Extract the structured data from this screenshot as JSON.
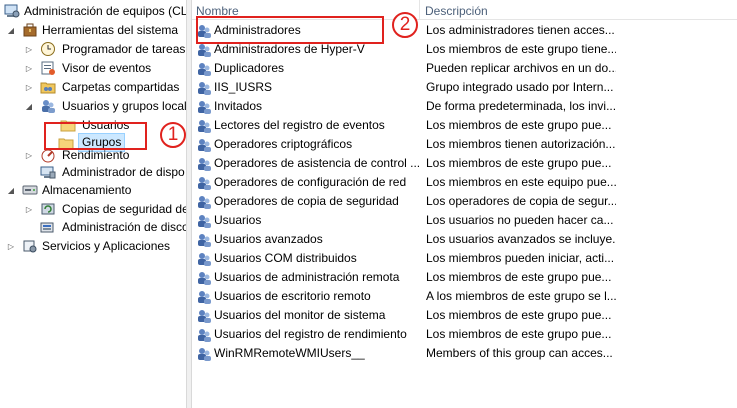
{
  "tree": {
    "root": "Administración de equipos (CL",
    "system_tools": "Herramientas del sistema",
    "task_scheduler": "Programador de tareas",
    "event_viewer": "Visor de eventos",
    "shared_folders": "Carpetas compartidas",
    "local_users_groups": "Usuarios y grupos locales",
    "users": "Usuarios",
    "groups": "Grupos",
    "performance": "Rendimiento",
    "device_manager": "Administrador de dispo",
    "storage": "Almacenamiento",
    "backup": "Copias de seguridad de",
    "disk_management": "Administración de disco",
    "services": "Servicios y Aplicaciones"
  },
  "columns": {
    "name": "Nombre",
    "description": "Descripción"
  },
  "groups": [
    {
      "name": "Administradores",
      "desc": "Los administradores tienen acces..."
    },
    {
      "name": "Administradores de Hyper-V",
      "desc": "Los miembros de este grupo tiene..."
    },
    {
      "name": "Duplicadores",
      "desc": "Pueden replicar archivos en un do..."
    },
    {
      "name": "IIS_IUSRS",
      "desc": "Grupo integrado usado por Intern..."
    },
    {
      "name": "Invitados",
      "desc": "De forma predeterminada, los invi..."
    },
    {
      "name": "Lectores del registro de eventos",
      "desc": "Los miembros de este grupo pue..."
    },
    {
      "name": "Operadores criptográficos",
      "desc": "Los miembros tienen autorización..."
    },
    {
      "name": "Operadores de asistencia de control ...",
      "desc": "Los miembros de este grupo pue..."
    },
    {
      "name": "Operadores de configuración de red",
      "desc": "Los miembros en este equipo pue..."
    },
    {
      "name": "Operadores de copia de seguridad",
      "desc": "Los operadores de copia de segur..."
    },
    {
      "name": "Usuarios",
      "desc": "Los usuarios no pueden hacer ca..."
    },
    {
      "name": "Usuarios avanzados",
      "desc": "Los usuarios avanzados se incluye..."
    },
    {
      "name": "Usuarios COM distribuidos",
      "desc": "Los miembros pueden iniciar, acti..."
    },
    {
      "name": "Usuarios de administración remota",
      "desc": "Los miembros de este grupo pue..."
    },
    {
      "name": "Usuarios de escritorio remoto",
      "desc": "A los miembros de este grupo se l..."
    },
    {
      "name": "Usuarios del monitor de sistema",
      "desc": "Los miembros de este grupo pue..."
    },
    {
      "name": "Usuarios del registro de rendimiento",
      "desc": "Los miembros de este grupo pue..."
    },
    {
      "name": "WinRMRemoteWMIUsers__",
      "desc": "Members of this group can acces..."
    }
  ],
  "annotations": {
    "one": "1",
    "two": "2"
  },
  "colors": {
    "annotation": "#e0221e",
    "selection": "#cce8ff",
    "header_text": "#4c607a"
  }
}
